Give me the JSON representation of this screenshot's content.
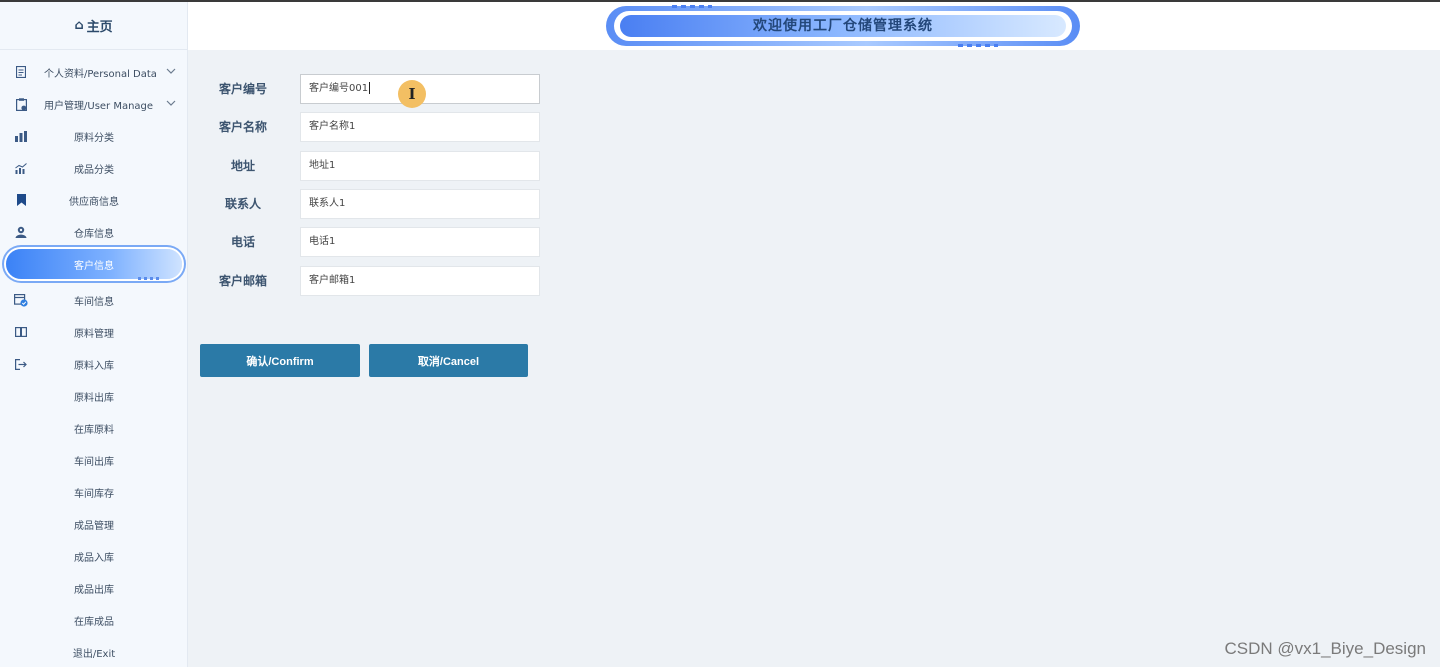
{
  "sidebar": {
    "home_label": "主页",
    "items": [
      {
        "label": "个人资料/Personal Data",
        "icon": "document-icon",
        "has_children": true
      },
      {
        "label": "用户管理/User Manage",
        "icon": "clipboard-icon",
        "has_children": true
      },
      {
        "label": "原料分类",
        "icon": "bar-chart-icon"
      },
      {
        "label": "成品分类",
        "icon": "growth-chart-icon"
      },
      {
        "label": "供应商信息",
        "icon": "bookmark-icon"
      },
      {
        "label": "仓库信息",
        "icon": "user-badge-icon"
      },
      {
        "label": "客户信息",
        "icon": "",
        "active": true
      },
      {
        "label": "车间信息",
        "icon": "calendar-check-icon"
      },
      {
        "label": "原料管理",
        "icon": "book-icon"
      },
      {
        "label": "原料入库",
        "icon": "login-icon"
      },
      {
        "label": "原料出库",
        "icon": ""
      },
      {
        "label": "在库原料",
        "icon": ""
      },
      {
        "label": "车间出库",
        "icon": ""
      },
      {
        "label": "车间库存",
        "icon": ""
      },
      {
        "label": "成品管理",
        "icon": ""
      },
      {
        "label": "成品入库",
        "icon": ""
      },
      {
        "label": "成品出库",
        "icon": ""
      },
      {
        "label": "在库成品",
        "icon": ""
      },
      {
        "label": "退出/Exit",
        "icon": ""
      }
    ]
  },
  "header": {
    "title": "欢迎使用工厂仓储管理系统"
  },
  "form": {
    "fields": [
      {
        "label": "客户编号",
        "value": "客户编号001"
      },
      {
        "label": "客户名称",
        "value": "客户名称1"
      },
      {
        "label": "地址",
        "value": "地址1"
      },
      {
        "label": "联系人",
        "value": "联系人1"
      },
      {
        "label": "电话",
        "value": "电话1"
      },
      {
        "label": "客户邮箱",
        "value": "客户邮箱1"
      }
    ],
    "confirm_label": "确认/Confirm",
    "cancel_label": "取消/Cancel"
  },
  "cursor_glyph": "I",
  "watermark": "CSDN @vx1_Biye_Design",
  "colors": {
    "accent": "#2b7aa7",
    "sidebar_bg": "#f4f8fd",
    "active_pill": "#3b82f6",
    "content_bg": "#eef2f6"
  }
}
